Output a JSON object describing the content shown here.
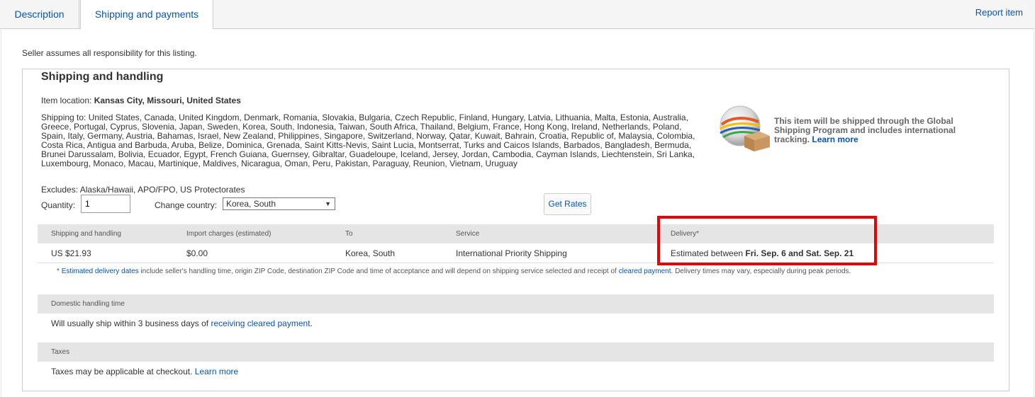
{
  "tabs": [
    {
      "label": "Description"
    },
    {
      "label": "Shipping and payments"
    }
  ],
  "report_item": "Report item",
  "seller_note": "Seller assumes all responsibility for this listing.",
  "shipping": {
    "title": "Shipping and handling",
    "item_location_label": "Item location:",
    "item_location_value": "Kansas City, Missouri, United States",
    "shipping_to": "Shipping to: United States, Canada, United Kingdom, Denmark, Romania, Slovakia, Bulgaria, Czech Republic, Finland, Hungary, Latvia, Lithuania, Malta, Estonia, Australia, Greece, Portugal, Cyprus, Slovenia, Japan, Sweden, Korea, South, Indonesia, Taiwan, South Africa, Thailand, Belgium, France, Hong Kong, Ireland, Netherlands, Poland, Spain, Italy, Germany, Austria, Bahamas, Israel, New Zealand, Philippines, Singapore, Switzerland, Norway, Qatar, Kuwait, Bahrain, Croatia, Republic of, Malaysia, Colombia, Costa Rica, Antigua and Barbuda, Aruba, Belize, Dominica, Grenada, Saint Kitts-Nevis, Saint Lucia, Montserrat, Turks and Caicos Islands, Barbados, Bangladesh, Bermuda, Brunei Darussalam, Bolivia, Ecuador, Egypt, French Guiana, Guernsey, Gibraltar, Guadeloupe, Iceland, Jersey, Jordan, Cambodia, Cayman Islands, Liechtenstein, Sri Lanka, Luxembourg, Monaco, Macau, Martinique, Maldives, Nicaragua, Oman, Peru, Pakistan, Paraguay, Reunion, Vietnam, Uruguay",
    "excludes": "Excludes: Alaska/Hawaii, APO/FPO, US Protectorates",
    "gsp_text": "This item will be shipped through the Global Shipping Program and includes international tracking.",
    "gsp_link": "Learn more",
    "quantity_label": "Quantity:",
    "quantity_value": "1",
    "country_label": "Change country:",
    "country_value": "Korea, South",
    "get_rates": "Get Rates"
  },
  "table": {
    "headers": [
      "Shipping and handling",
      "Import charges (estimated)",
      "To",
      "Service",
      "Delivery*"
    ],
    "row": {
      "cost": "US $21.93",
      "import": "$0.00",
      "to": "Korea, South",
      "service": "International Priority Shipping",
      "delivery_prefix": "Estimated between",
      "delivery_dates": "Fri. Sep. 6 and Sat. Sep. 21"
    }
  },
  "footnote": {
    "star": "*",
    "link1": "Estimated delivery dates",
    "text1": "include seller's handling time, origin ZIP Code, destination ZIP Code and time of acceptance and will depend on shipping service selected and receipt of",
    "link2": "cleared payment",
    "text2": ". Delivery times may vary, especially during peak periods."
  },
  "domestic": {
    "heading": "Domestic handling time",
    "text": "Will usually ship within 3 business days of",
    "link": "receiving cleared payment",
    "end": "."
  },
  "taxes": {
    "heading": "Taxes",
    "text": "Taxes may be applicable at checkout.",
    "link": "Learn more"
  }
}
